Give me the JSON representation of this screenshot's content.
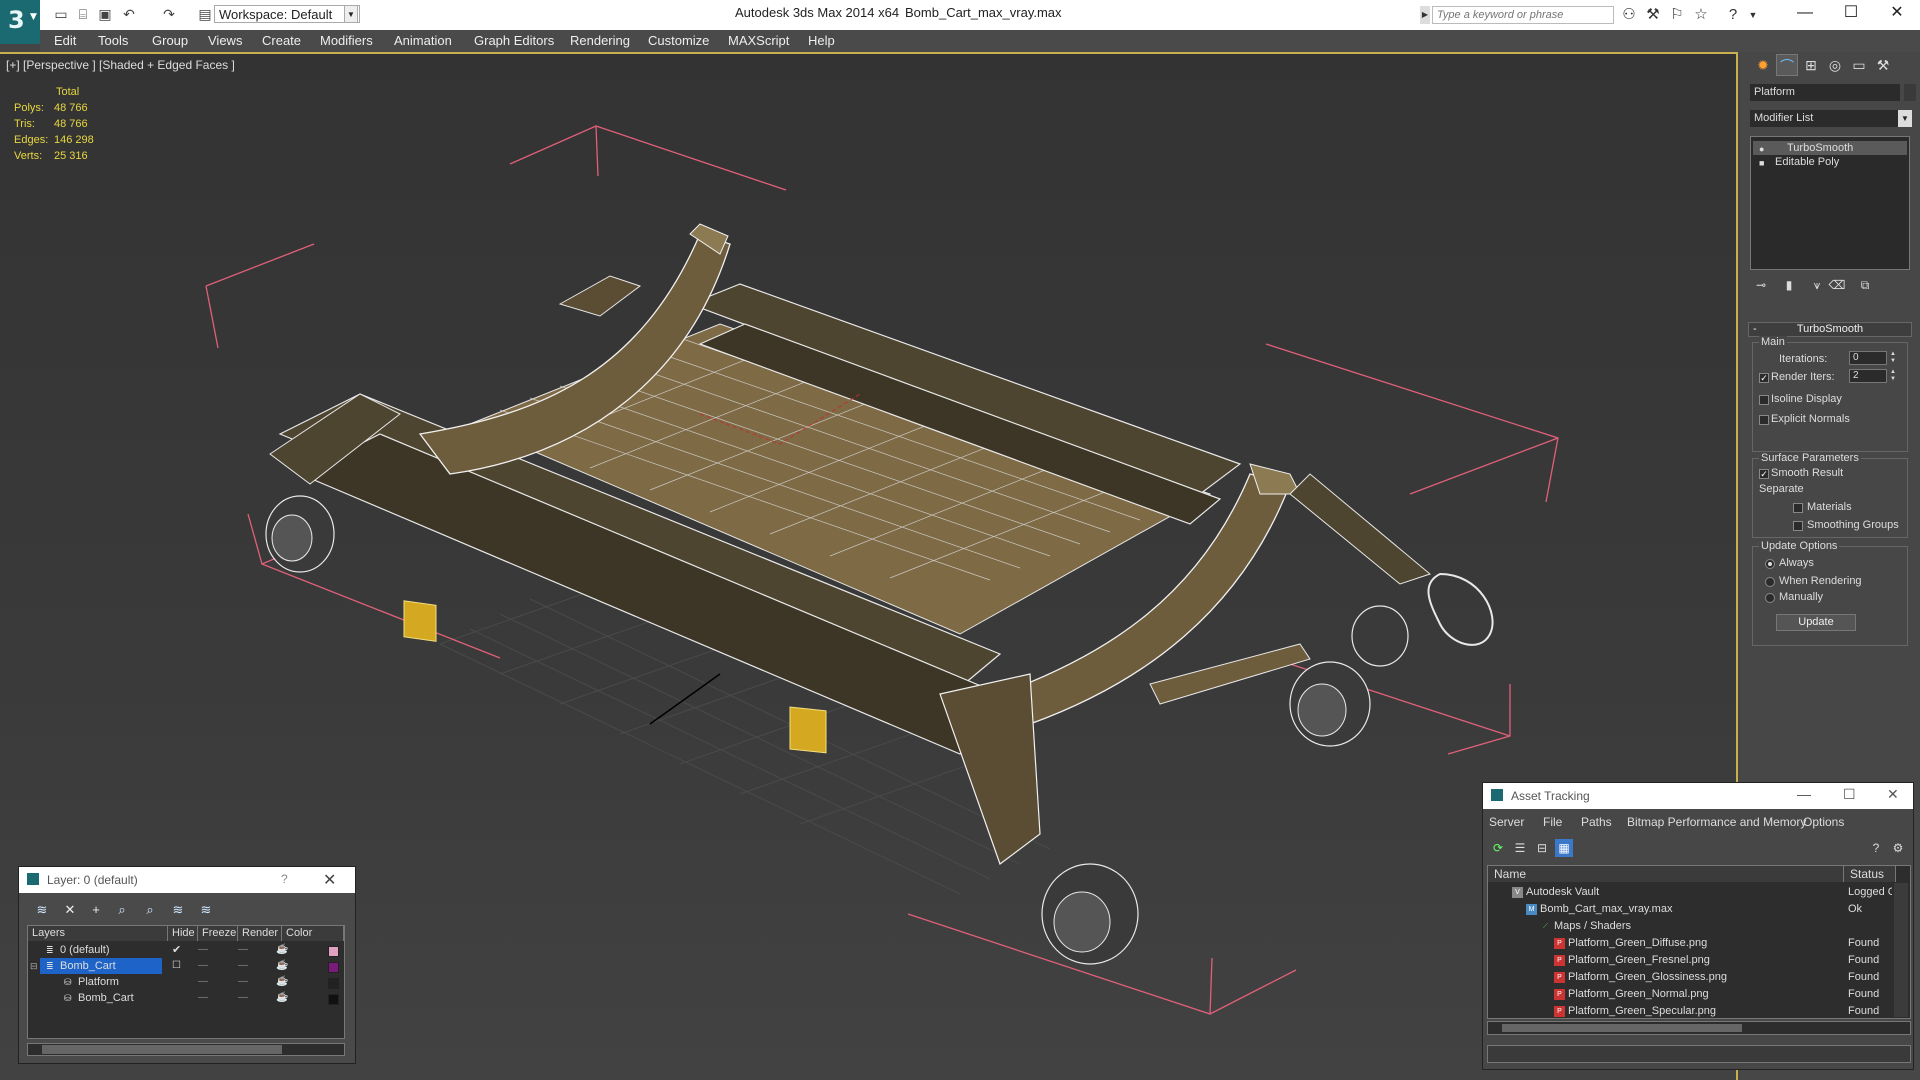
{
  "titlebar": {
    "workspace": "Workspace: Default",
    "app_title": "Autodesk 3ds Max  2014 x64",
    "file_name": "Bomb_Cart_max_vray.max",
    "search_placeholder": "Type a keyword or phrase"
  },
  "menu": [
    "Edit",
    "Tools",
    "Group",
    "Views",
    "Create",
    "Modifiers",
    "Animation",
    "Graph Editors",
    "Rendering",
    "Customize",
    "MAXScript",
    "Help"
  ],
  "viewport": {
    "label": "[+] [Perspective ] [Shaded + Edged Faces ]",
    "stats": {
      "header": "Total",
      "rows": [
        {
          "key": "Polys:",
          "value": "48 766"
        },
        {
          "key": "Tris:",
          "value": "48 766"
        },
        {
          "key": "Edges:",
          "value": "146 298"
        },
        {
          "key": "Verts:",
          "value": "25 316"
        }
      ]
    }
  },
  "command_panel": {
    "object_name": "Platform",
    "modifier_list": "Modifier List",
    "stack": [
      "TurboSmooth",
      "Editable Poly"
    ],
    "rollout_title": "TurboSmooth",
    "main_group": "Main",
    "iterations_label": "Iterations:",
    "iterations_value": "0",
    "render_iters_label": "Render Iters:",
    "render_iters_value": "2",
    "isoline_display": "Isoline Display",
    "explicit_normals": "Explicit Normals",
    "surface_params_group": "Surface Parameters",
    "smooth_result": "Smooth Result",
    "separate_label": "Separate",
    "materials": "Materials",
    "smoothing_groups": "Smoothing Groups",
    "update_options_group": "Update Options",
    "always": "Always",
    "when_rendering": "When Rendering",
    "manually": "Manually",
    "update_button": "Update"
  },
  "layer_dialog": {
    "title": "Layer: 0 (default)",
    "help": "?",
    "columns": [
      "Layers",
      "Hide",
      "Freeze",
      "Render",
      "Color"
    ],
    "rows": [
      {
        "name": "0 (default)",
        "color": "#e0a0c0",
        "selected": false
      },
      {
        "name": "Bomb_Cart",
        "color": "#7a1a7a",
        "selected": true
      },
      {
        "name": "Platform",
        "color": "#222222",
        "selected": false
      },
      {
        "name": "Bomb_Cart",
        "color": "#111111",
        "selected": false
      }
    ]
  },
  "asset_tracking": {
    "title": "Asset Tracking",
    "menu": [
      "Server",
      "File",
      "Paths",
      "Bitmap Performance and Memory",
      "Options"
    ],
    "columns": [
      "Name",
      "Status"
    ],
    "rows": [
      {
        "name": "Autodesk Vault",
        "status": "Logged Out",
        "indent": 0
      },
      {
        "name": "Bomb_Cart_max_vray.max",
        "status": "Ok",
        "indent": 1
      },
      {
        "name": "Maps / Shaders",
        "status": "",
        "indent": 2
      },
      {
        "name": "Platform_Green_Diffuse.png",
        "status": "Found",
        "indent": 3
      },
      {
        "name": "Platform_Green_Fresnel.png",
        "status": "Found",
        "indent": 3
      },
      {
        "name": "Platform_Green_Glossiness.png",
        "status": "Found",
        "indent": 3
      },
      {
        "name": "Platform_Green_Normal.png",
        "status": "Found",
        "indent": 3
      },
      {
        "name": "Platform_Green_Specular.png",
        "status": "Found",
        "indent": 3
      }
    ]
  },
  "colors": {
    "viewport_border": "#c9b04e",
    "stats_text": "#e8d640",
    "selection_blue": "#1e64c8",
    "bbox_pink": "#e0607a",
    "model_brown": "#6b5a3a"
  }
}
